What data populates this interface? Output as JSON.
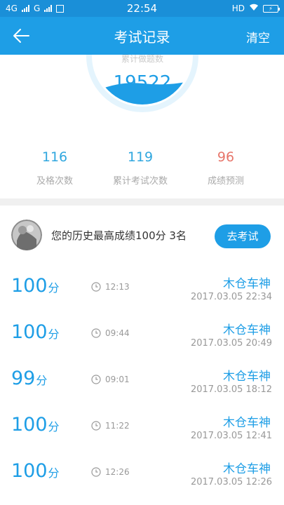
{
  "status_bar": {
    "network_left": "4G",
    "network_mid": "G",
    "time": "22:54",
    "hd": "HD",
    "battery": "⚡"
  },
  "header": {
    "title": "考试记录",
    "clear_label": "清空"
  },
  "summary": {
    "caption": "累计做题数",
    "total": "19522",
    "stats": [
      {
        "value": "116",
        "label": "及格次数"
      },
      {
        "value": "119",
        "label": "累计考试次数"
      },
      {
        "value": "96",
        "label": "成绩预测"
      }
    ]
  },
  "best": {
    "text": "您的历史最高成绩100分  3名",
    "button": "去考试"
  },
  "records": [
    {
      "score": "100",
      "unit": "分",
      "duration": "12:13",
      "name": "木仓车神",
      "date": "2017.03.05  22:34"
    },
    {
      "score": "100",
      "unit": "分",
      "duration": "09:44",
      "name": "木仓车神",
      "date": "2017.03.05  20:49"
    },
    {
      "score": "99",
      "unit": "分",
      "duration": "09:01",
      "name": "木仓车神",
      "date": "2017.03.05  18:12"
    },
    {
      "score": "100",
      "unit": "分",
      "duration": "11:22",
      "name": "木仓车神",
      "date": "2017.03.05  12:41"
    },
    {
      "score": "100",
      "unit": "分",
      "duration": "12:26",
      "name": "木仓车神",
      "date": "2017.03.05  12:26"
    }
  ],
  "colors": {
    "primary": "#1e9ee6",
    "status_bar": "#1a8fd8",
    "warning": "#e7766b"
  }
}
